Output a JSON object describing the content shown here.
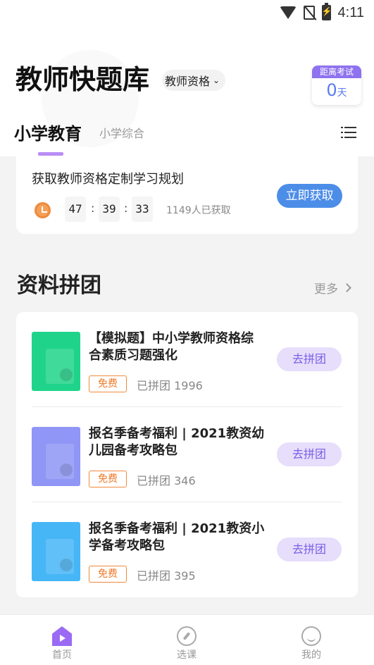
{
  "status_bar": {
    "time": "4:11",
    "icons": [
      "wifi-icon",
      "no-sim-icon",
      "battery-charging-icon"
    ]
  },
  "header": {
    "app_title": "教师快题库",
    "qualification_select": "教师资格",
    "exam_countdown": {
      "label": "距离考试",
      "value": "0",
      "unit": "天"
    }
  },
  "tabs": {
    "active": "小学教育",
    "secondary": "小学综合"
  },
  "promo": {
    "title": "获取教师资格定制学习规划",
    "timer": {
      "hours": "47",
      "minutes": "39",
      "seconds": "33",
      "separator": ":"
    },
    "taken_count": "1149人已获取",
    "button_label": "立即获取"
  },
  "section": {
    "title": "资料拼团",
    "more_label": "更多"
  },
  "items": [
    {
      "title": "【模拟题】中小学教师资格综合素质习题强化",
      "tag": "免费",
      "group_count": "已拼团 1996",
      "button_label": "去拼团",
      "cover_color": "#1fd48a"
    },
    {
      "title": "报名季备考福利 | 2021教资幼儿园备考攻略包",
      "tag": "免费",
      "group_count": "已拼团 346",
      "button_label": "去拼团",
      "cover_color": "#8f96f5"
    },
    {
      "title": "报名季备考福利 | 2021教资小学备考攻略包",
      "tag": "免费",
      "group_count": "已拼团 395",
      "button_label": "去拼团",
      "cover_color": "#46b6f6"
    }
  ],
  "bottom_nav": [
    {
      "label": "首页",
      "icon": "home-icon",
      "active": true
    },
    {
      "label": "选课",
      "icon": "compass-icon",
      "active": false
    },
    {
      "label": "我的",
      "icon": "profile-icon",
      "active": false
    }
  ],
  "colors": {
    "accent": "#9b6af4",
    "primary_button": "#4c8de8",
    "free_tag": "#ef7a2a"
  }
}
